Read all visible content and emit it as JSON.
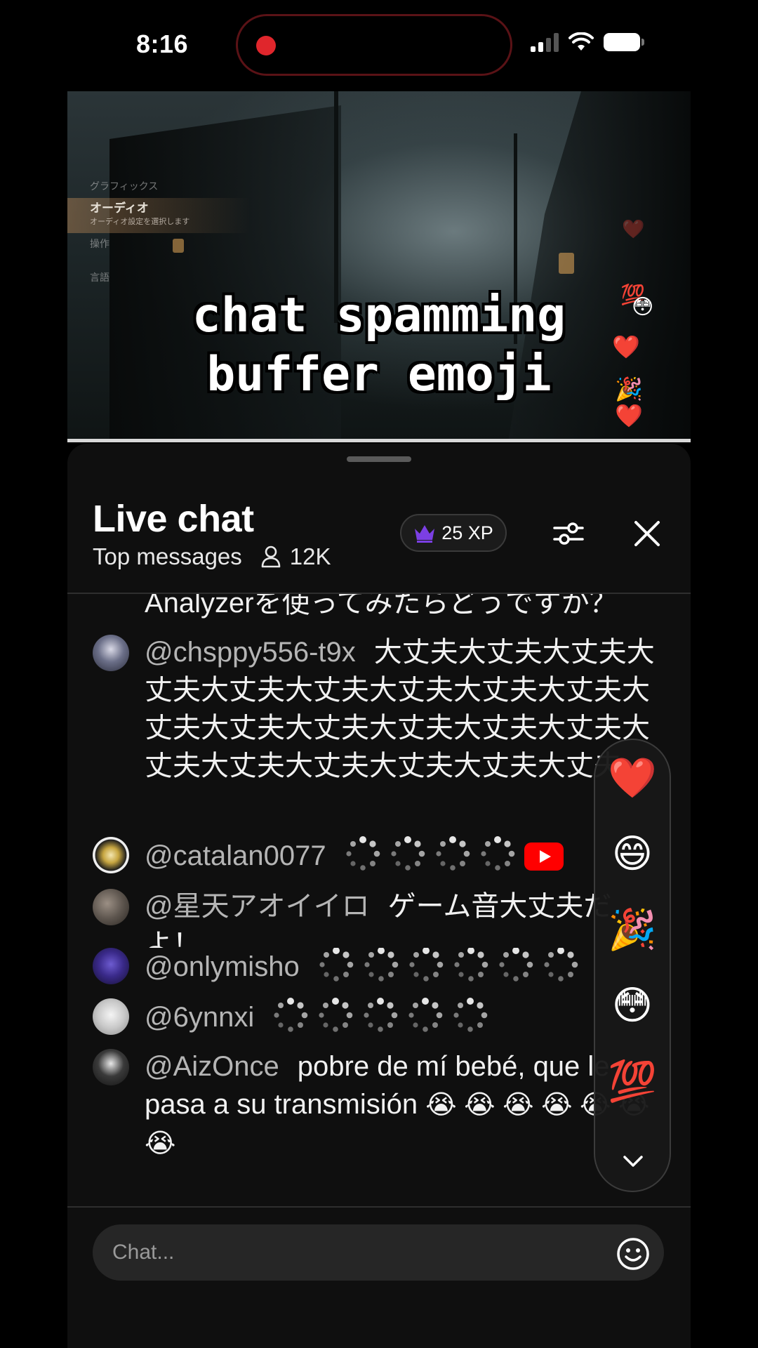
{
  "status_bar": {
    "time": "8:16"
  },
  "video": {
    "caption_lines": [
      "chat spamming",
      "buffer emoji"
    ],
    "game_menu": {
      "items": [
        "グラフィックス",
        "操作",
        "言語"
      ],
      "active_title": "オーディオ",
      "active_subtitle": "オーディオ設定を選択します"
    },
    "floating_emojis": [
      "💯",
      "😳",
      "❤️",
      "🎉",
      "❤️",
      "❤️"
    ]
  },
  "chat": {
    "title": "Live chat",
    "mode": "Top messages",
    "viewers": "12K",
    "xp": "25 XP",
    "messages": [
      {
        "author": "",
        "text": "Analyzerを使ってみたらどうですか？"
      },
      {
        "author": "@chsppy556-t9x",
        "text": "大丈夫大丈夫大丈夫大丈夫大丈夫大丈夫大丈夫大丈夫大丈夫大丈夫大丈夫大丈夫大丈夫大丈夫大丈夫大丈夫大丈夫大丈夫大丈夫大丈夫大丈夫"
      },
      {
        "author": "@catalan0077",
        "text": ""
      },
      {
        "author": "@星天アオイイロ",
        "text": "ゲーム音大丈夫だよ！"
      },
      {
        "author": "@onlymisho",
        "text": ""
      },
      {
        "author": "@6ynnxi",
        "text": ""
      },
      {
        "author": "@AizOnce",
        "text": "pobre de mí bebé, que le pasa a su transmisión",
        "emojis": "😭 😭 😭 😭 😭 😭 😭"
      }
    ],
    "reactions": [
      "❤️",
      "😄",
      "🎉",
      "😳",
      "💯"
    ],
    "input_placeholder": "Chat..."
  },
  "colors": {
    "background": "#000000",
    "panel": "#0f0f0f",
    "author": "#b5b5b5",
    "crown": "#7b3fe4",
    "youtube_red": "#ff0000",
    "record_dot": "#e0262c"
  },
  "icons": [
    "crown-icon",
    "viewer-icon",
    "tune-icon",
    "close-icon",
    "buffering-icon",
    "youtube-icon",
    "chevron-down-icon",
    "smile-icon"
  ]
}
